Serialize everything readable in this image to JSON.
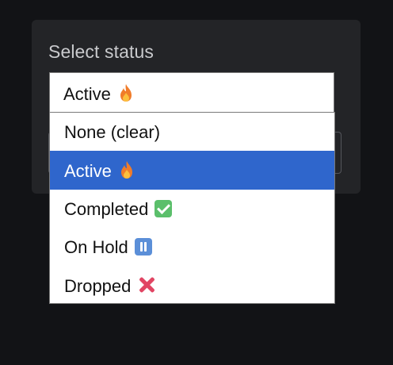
{
  "panel": {
    "title": "Select status"
  },
  "select": {
    "value": "Active",
    "value_icon": "flame-icon"
  },
  "options": [
    {
      "label": "None (clear)",
      "icon": ""
    },
    {
      "label": "Active",
      "icon": "flame-icon",
      "selected": true
    },
    {
      "label": "Completed",
      "icon": "check-mark-icon"
    },
    {
      "label": "On Hold",
      "icon": "pause-icon"
    },
    {
      "label": "Dropped",
      "icon": "cross-mark-icon"
    }
  ],
  "colors": {
    "background": "#121316",
    "panel": "#232427",
    "selected_option": "#2f66cc",
    "check": "#5bbf6b",
    "pause": "#5b8fd8",
    "cross": "#e14563"
  }
}
